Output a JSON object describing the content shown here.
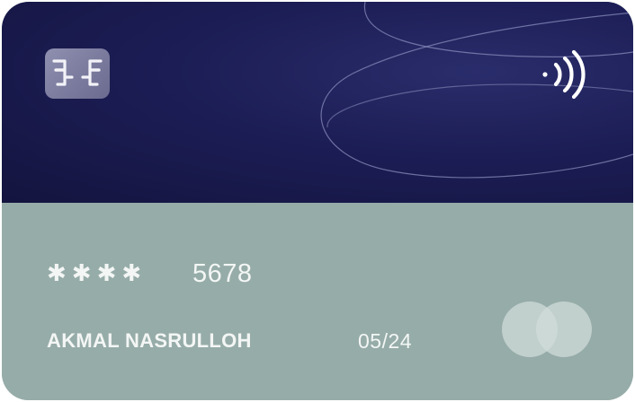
{
  "card": {
    "masked_digits": "✱✱✱✱",
    "last4": "5678",
    "holder_name": "AKMAL NASRULLOH",
    "expiry": "05/24",
    "chip_icon": "card-chip-icon",
    "contactless_icon": "contactless-icon",
    "brand_icon": "mastercard-logo-icon",
    "colors": {
      "top_background": "#1c1d55",
      "bottom_background": "#96aca8",
      "text": "#f3f6f5"
    }
  }
}
